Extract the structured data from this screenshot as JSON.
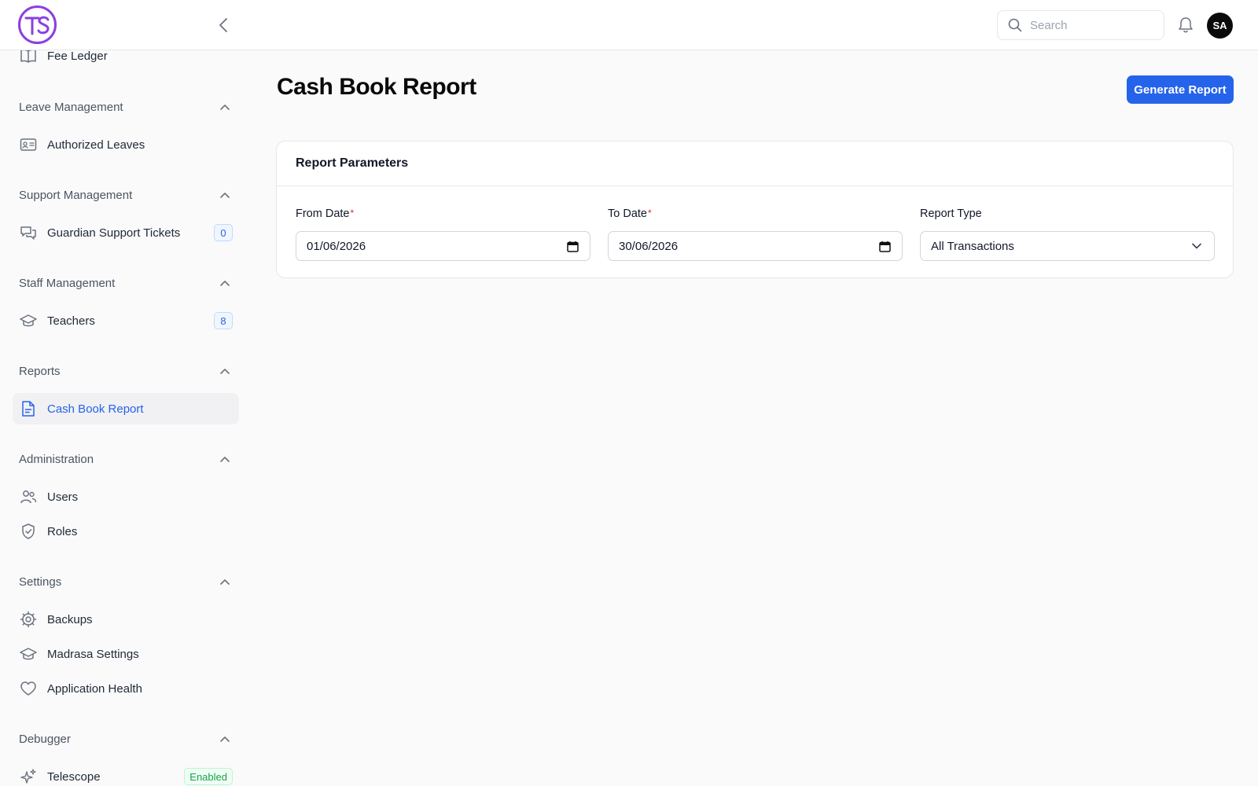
{
  "app": {
    "logo_text": "TS",
    "colors": {
      "primary": "#2563eb",
      "logo": "#8b3fe0",
      "required": "#dc2626"
    }
  },
  "header": {
    "search_placeholder": "Search",
    "avatar_initials": "SA"
  },
  "sidebar": {
    "items": [
      {
        "label": "Fee Ledger",
        "icon": "book-open-icon"
      },
      {
        "group": "Leave Management",
        "expanded": true
      },
      {
        "label": "Authorized Leaves",
        "icon": "id-card-icon"
      },
      {
        "group": "Support Management",
        "expanded": true
      },
      {
        "label": "Guardian Support Tickets",
        "icon": "chat-bubbles-icon",
        "badge": "0"
      },
      {
        "group": "Staff Management",
        "expanded": true
      },
      {
        "label": "Teachers",
        "icon": "graduation-cap-icon",
        "badge": "8"
      },
      {
        "group": "Reports",
        "expanded": true
      },
      {
        "label": "Cash Book Report",
        "icon": "document-icon",
        "active": true
      },
      {
        "group": "Administration",
        "expanded": true
      },
      {
        "label": "Users",
        "icon": "users-icon"
      },
      {
        "label": "Roles",
        "icon": "shield-check-icon"
      },
      {
        "group": "Settings",
        "expanded": true
      },
      {
        "label": "Backups",
        "icon": "cog-icon"
      },
      {
        "label": "Madrasa Settings",
        "icon": "graduation-cap-icon"
      },
      {
        "label": "Application Health",
        "icon": "heart-icon"
      },
      {
        "group": "Debugger",
        "expanded": true
      },
      {
        "label": "Telescope",
        "icon": "sparkles-icon",
        "badge": "Enabled"
      }
    ]
  },
  "main": {
    "title": "Cash Book Report",
    "generate_button": "Generate Report",
    "card": {
      "title": "Report Parameters",
      "fields": [
        {
          "label": "From Date",
          "required": "*",
          "value": "01/06/2026",
          "icon": "calendar-icon"
        },
        {
          "label": "To Date",
          "required": "*",
          "value": "30/06/2026",
          "icon": "calendar-icon"
        },
        {
          "label": "Report Type",
          "value": "All Transactions",
          "icon": "chevron-down-icon"
        }
      ]
    }
  }
}
